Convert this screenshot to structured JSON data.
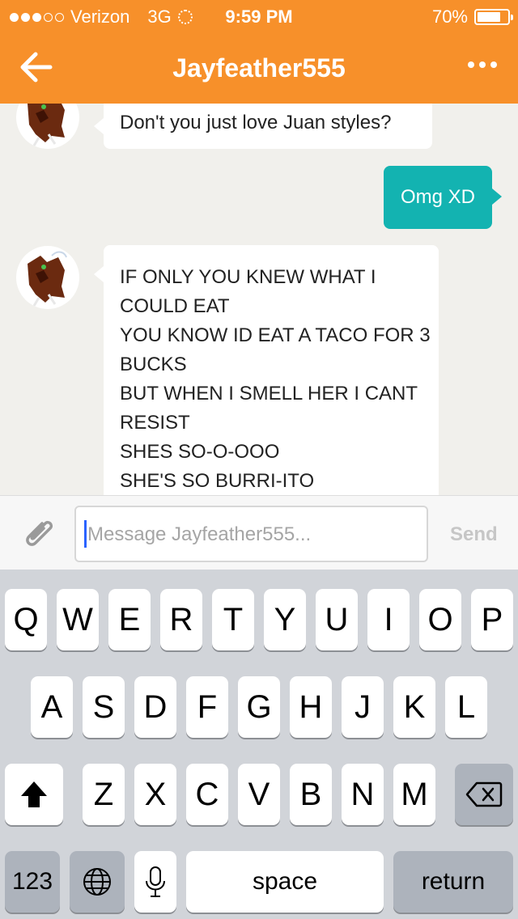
{
  "status_bar": {
    "carrier": "Verizon",
    "network": "3G",
    "time": "9:59 PM",
    "battery": "70%",
    "signal_bars_filled": 3,
    "signal_bars_total": 5
  },
  "header": {
    "title": "Jayfeather555",
    "back_icon": "arrow-left-icon",
    "menu_icon": "more-dots-icon",
    "color": "#f7902a"
  },
  "messages": [
    {
      "sender": "Jayfeather555",
      "direction": "incoming",
      "lines": [
        "Don't you just love Juan styles?"
      ]
    },
    {
      "sender": "me",
      "direction": "outgoing",
      "lines": [
        "Omg XD"
      ]
    },
    {
      "sender": "Jayfeather555",
      "direction": "incoming",
      "lines": [
        "IF ONLY YOU KNEW WHAT I",
        "COULD EAT",
        "YOU KNOW ID EAT A TACO FOR 3",
        "BUCKS",
        "BUT WHEN I SMELL HER I CANT",
        "RESIST",
        "SHES SO-O-OOO",
        "SHE'S SO BURRI-ITO"
      ]
    }
  ],
  "composer": {
    "attach_icon": "paperclip-icon",
    "placeholder": "Message Jayfeather555...",
    "value": "",
    "send_label": "Send"
  },
  "keyboard": {
    "row1": [
      "Q",
      "W",
      "E",
      "R",
      "T",
      "Y",
      "U",
      "I",
      "O",
      "P"
    ],
    "row2": [
      "A",
      "S",
      "D",
      "F",
      "G",
      "H",
      "J",
      "K",
      "L"
    ],
    "row3": [
      "Z",
      "X",
      "C",
      "V",
      "B",
      "N",
      "M"
    ],
    "numbers_label": "123",
    "space_label": "space",
    "return_label": "return",
    "shift_icon": "shift-arrow-icon",
    "delete_icon": "backspace-icon",
    "globe_icon": "globe-icon",
    "mic_icon": "microphone-icon"
  },
  "colors": {
    "accent": "#f7902a",
    "outgoing_bubble": "#13b3b1",
    "chat_background": "#f1f0ec"
  }
}
